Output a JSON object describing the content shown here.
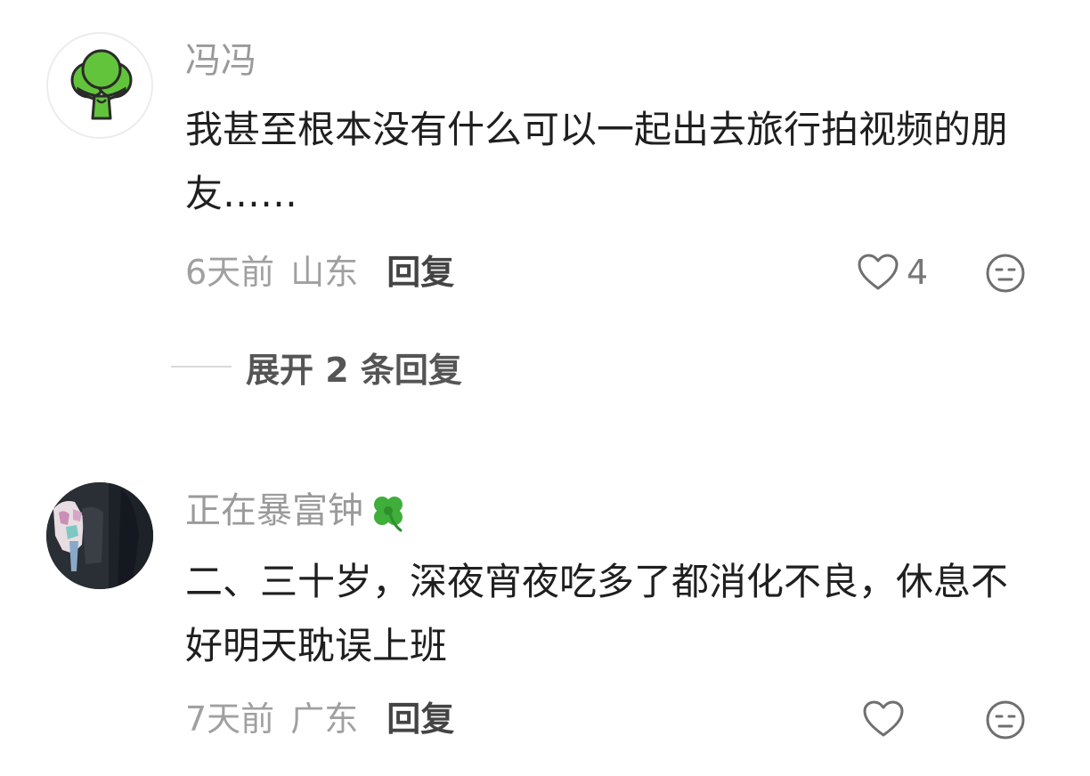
{
  "comments": [
    {
      "username": "冯冯",
      "avatar_icon": "broccoli-icon",
      "text": "我甚至根本没有什么可以一起出去旅行拍视频的朋友……",
      "time": "6天前",
      "region": "山东",
      "reply_label": "回复",
      "like_count": "4",
      "expand_label": "展开 2 条回复"
    },
    {
      "username": "正在暴富钟",
      "name_badge_icon": "four-leaf-clover-icon",
      "avatar_icon": "photo-avatar",
      "text": "二、三十岁，深夜宵夜吃多了都消化不良，休息不好明天耽误上班",
      "time": "7天前",
      "region": "广东",
      "reply_label": "回复",
      "like_count": ""
    }
  ],
  "colors": {
    "username": "#9a9a9a",
    "body_text": "#1f1f1f",
    "meta": "#a0a0a0",
    "reply": "#444444",
    "broccoli_green": "#62c43a"
  }
}
